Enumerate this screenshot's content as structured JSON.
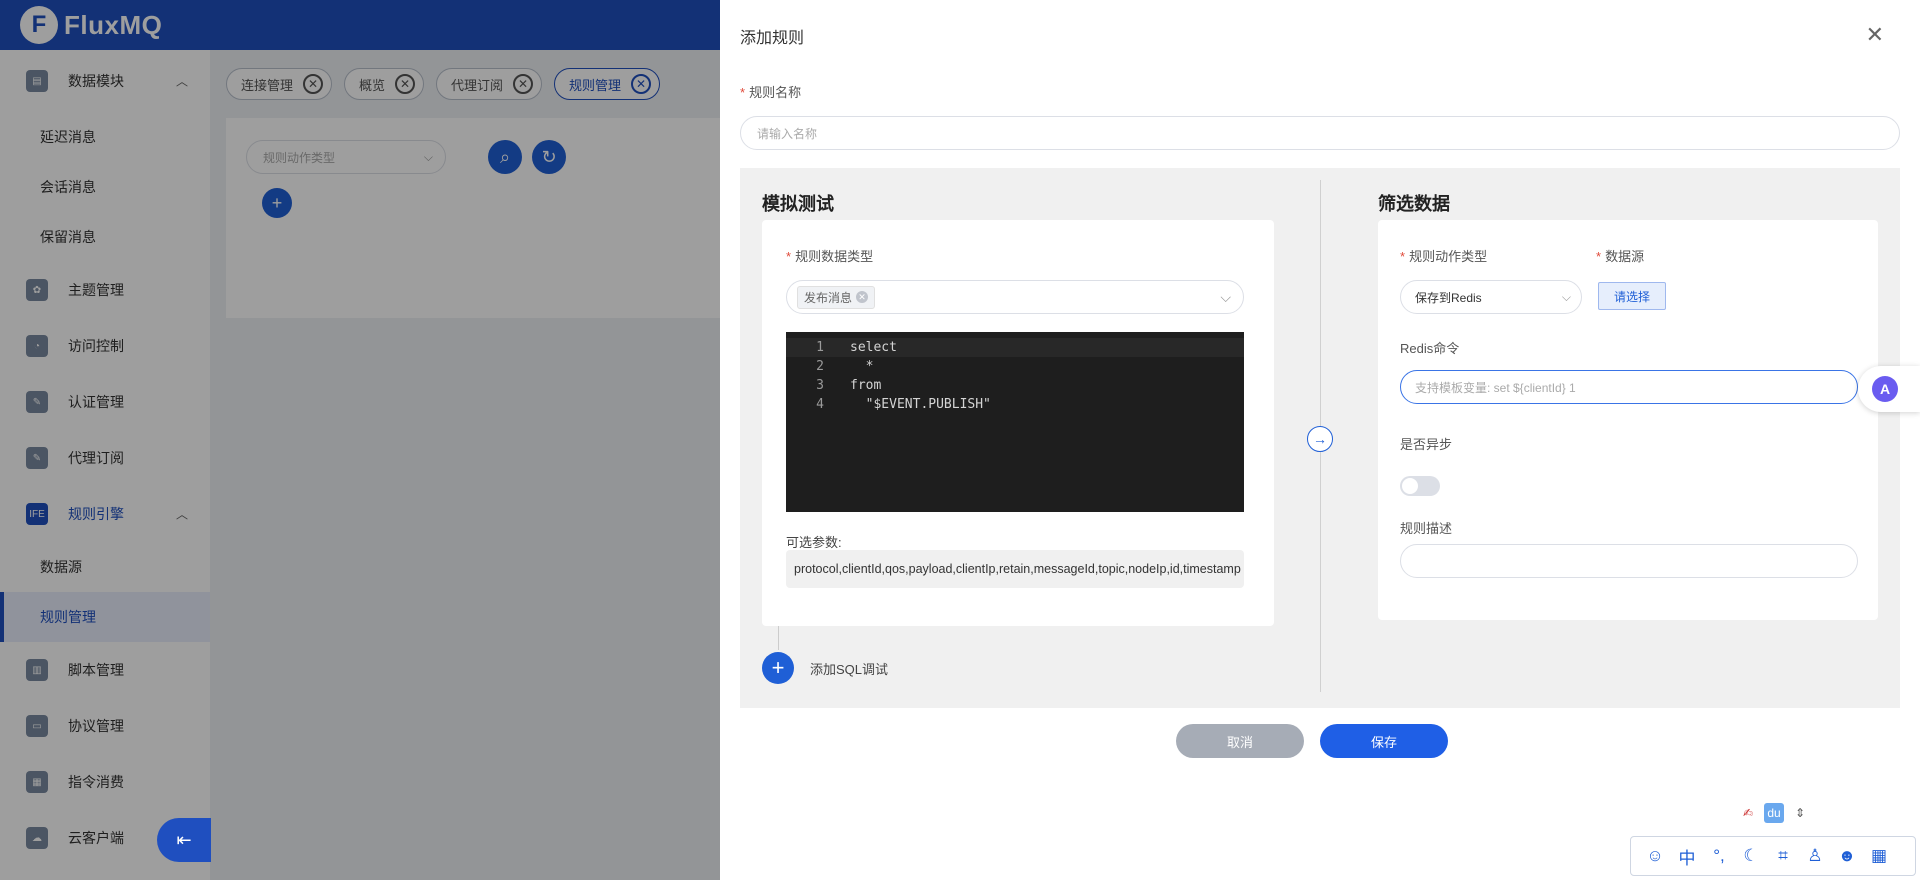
{
  "header": {
    "logo_letter": "F",
    "app_name": "FluxMQ"
  },
  "sidebar": {
    "items": [
      {
        "label": "数据模块",
        "icon": "database-icon",
        "expanded": true
      },
      {
        "label": "延迟消息",
        "sub": true
      },
      {
        "label": "会话消息",
        "sub": true
      },
      {
        "label": "保留消息",
        "sub": true
      },
      {
        "label": "主题管理",
        "icon": "topic-icon"
      },
      {
        "label": "访问控制",
        "icon": "access-control-icon"
      },
      {
        "label": "认证管理",
        "icon": "auth-icon"
      },
      {
        "label": "代理订阅",
        "icon": "proxy-subscribe-icon"
      },
      {
        "label": "规则引擎",
        "icon": "rule-engine-icon",
        "expanded": true,
        "active": true
      },
      {
        "label": "数据源",
        "sub": true
      },
      {
        "label": "规则管理",
        "sub": true,
        "active": true
      },
      {
        "label": "脚本管理",
        "icon": "script-icon"
      },
      {
        "label": "协议管理",
        "icon": "protocol-icon"
      },
      {
        "label": "指令消费",
        "icon": "command-icon"
      },
      {
        "label": "云客户端",
        "icon": "cloud-client-icon"
      }
    ]
  },
  "tabs": [
    {
      "label": "连接管理"
    },
    {
      "label": "概览"
    },
    {
      "label": "代理订阅"
    },
    {
      "label": "规则管理",
      "active": true
    }
  ],
  "main": {
    "filter_placeholder": "规则动作类型"
  },
  "drawer": {
    "title": "添加规则",
    "rule_name_label": "规则名称",
    "rule_name_placeholder": "请输入名称",
    "sim_test": {
      "title": "模拟测试",
      "data_type_label": "规则数据类型",
      "data_type_chip": "发布消息",
      "code_lines": [
        {
          "n": "1",
          "text": "select"
        },
        {
          "n": "2",
          "text": "  *"
        },
        {
          "n": "3",
          "text": "from"
        },
        {
          "n": "4",
          "text": "  \"$EVENT.PUBLISH\""
        }
      ],
      "params_label": "可选参数:",
      "params": "protocol,clientId,qos,payload,clientIp,retain,messageId,topic,nodeIp,id,timestamp",
      "add_sql_label": "添加SQL调试"
    },
    "filter": {
      "title": "筛选数据",
      "action_type_label": "规则动作类型",
      "action_type_value": "保存到Redis",
      "datasource_label": "数据源",
      "choose_label": "请选择",
      "redis_cmd_label": "Redis命令",
      "redis_cmd_placeholder": "支持模板变量: set ${clientId} 1",
      "async_label": "是否异步",
      "async_on": false,
      "desc_label": "规则描述"
    },
    "cancel_label": "取消",
    "save_label": "保存"
  },
  "ime": {
    "zh_label": "中",
    "du_label": "du"
  },
  "colors": {
    "primary": "#1f5fe6",
    "header": "#1f4fbf",
    "required": "#e04a3a"
  }
}
